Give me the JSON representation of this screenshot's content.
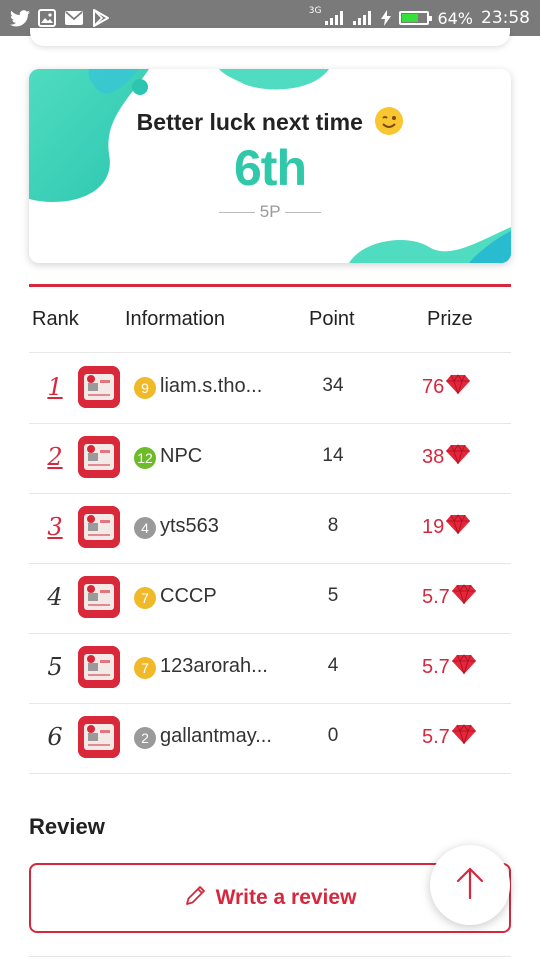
{
  "status_bar": {
    "network_type": "3G",
    "battery_percent": "64%",
    "time": "23:58",
    "left_icons": [
      "twitter-icon",
      "image-icon",
      "mail-icon",
      "play-store-icon"
    ]
  },
  "result": {
    "message": "Better luck next time",
    "emoji": "winking-face",
    "place": "6th",
    "points": "5P"
  },
  "table": {
    "headers": {
      "rank": "Rank",
      "information": "Information",
      "point": "Point",
      "prize": "Prize"
    },
    "rows": [
      {
        "rank": "1",
        "level": "9",
        "level_color": "#f0b928",
        "name": "liam.s.tho...",
        "point": "34",
        "prize": "76"
      },
      {
        "rank": "2",
        "level": "12",
        "level_color": "#6dbb2a",
        "name": "NPC",
        "point": "14",
        "prize": "38"
      },
      {
        "rank": "3",
        "level": "4",
        "level_color": "#9a9a9a",
        "name": "yts563",
        "point": "8",
        "prize": "19"
      },
      {
        "rank": "4",
        "level": "7",
        "level_color": "#f0b928",
        "name": "CCCP",
        "point": "5",
        "prize": "5.7"
      },
      {
        "rank": "5",
        "level": "7",
        "level_color": "#f0b928",
        "name": "123arorah...",
        "point": "4",
        "prize": "5.7"
      },
      {
        "rank": "6",
        "level": "2",
        "level_color": "#9a9a9a",
        "name": "gallantmay...",
        "point": "0",
        "prize": "5.7"
      }
    ]
  },
  "review": {
    "title": "Review",
    "button_label": "Write a review"
  },
  "colors": {
    "accent": "#d6283d",
    "teal": "#2fc8a9",
    "status_bar": "#7a7a7a"
  }
}
